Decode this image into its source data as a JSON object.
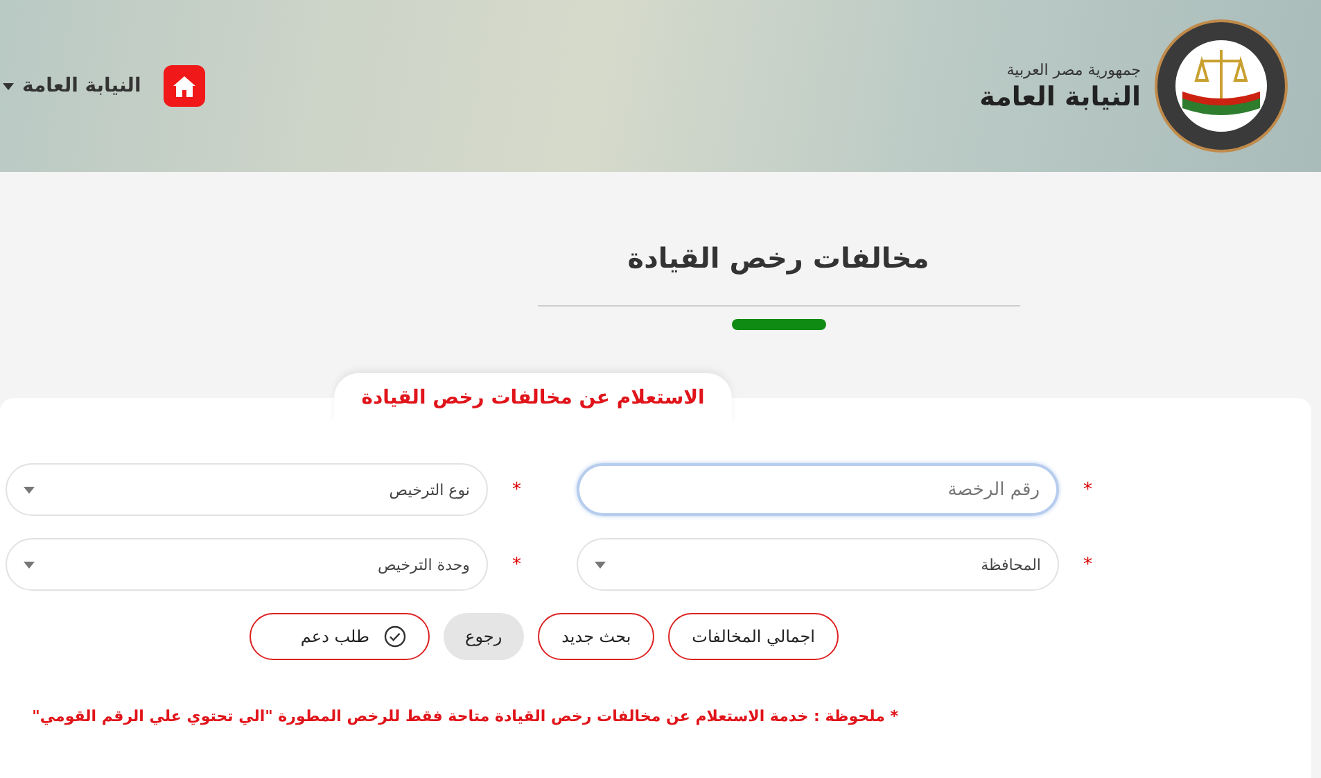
{
  "header": {
    "subtitle": "جمهورية مصر العربية",
    "title": "النيابة العامة",
    "user_menu": "النيابة العامة"
  },
  "page_title": "مخالفات رخص القيادة",
  "form": {
    "legend": "الاستعلام عن مخالفات رخص القيادة",
    "rows": [
      [
        {
          "kind": "text",
          "placeholder": "رقم الرخصة",
          "required_mark": "*",
          "focused": true
        },
        {
          "kind": "select",
          "value": "نوع الترخيص",
          "required_mark": "*",
          "focused": false
        }
      ],
      [
        {
          "kind": "select",
          "value": "المحافظة",
          "required_mark": "*",
          "focused": false
        },
        {
          "kind": "select",
          "value": "وحدة الترخيص",
          "required_mark": "*",
          "focused": false
        }
      ]
    ],
    "buttons": [
      {
        "kind": "outline",
        "label": "اجمالي المخالفات"
      },
      {
        "kind": "outline",
        "label": "بحث جديد"
      },
      {
        "kind": "grey",
        "label": "رجوع"
      },
      {
        "kind": "support",
        "label": "طلب دعم"
      }
    ],
    "note": "* ملحوظة : خدمة الاستعلام عن مخالفات رخص القيادة متاحة فقط للرخص المطورة \"الي تحتوي علي الرقم القومي\""
  }
}
